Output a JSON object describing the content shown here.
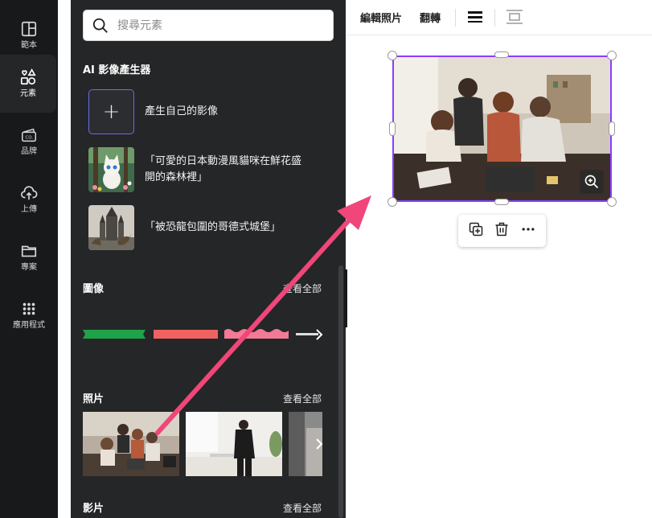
{
  "rail": {
    "items": [
      {
        "label": "範本",
        "icon": "template-icon"
      },
      {
        "label": "元素",
        "icon": "elements-icon"
      },
      {
        "label": "品牌",
        "icon": "brand-icon"
      },
      {
        "label": "上傳",
        "icon": "upload-icon"
      },
      {
        "label": "專案",
        "icon": "folder-icon"
      },
      {
        "label": "應用程式",
        "icon": "apps-icon"
      }
    ]
  },
  "panel": {
    "search": {
      "placeholder": "搜尋元素"
    },
    "ai_section": {
      "title": "AI 影像產生器",
      "items": [
        {
          "text": "產生自己的影像"
        },
        {
          "text_line1": "「可愛的日本動漫風貓咪在鮮花盛",
          "text_line2": "開的森林裡」"
        },
        {
          "text": "「被恐龍包圍的哥德式城堡」"
        }
      ]
    },
    "graphics": {
      "title": "圖像",
      "see_all": "查看全部"
    },
    "photos": {
      "title": "照片",
      "see_all": "查看全部"
    },
    "videos": {
      "title": "影片",
      "see_all": "查看全部"
    }
  },
  "toolbar": {
    "edit_photo": "編輯照片",
    "flip": "翻轉"
  },
  "colors": {
    "accent": "#8b3dff",
    "arrow": "#f0467a"
  }
}
